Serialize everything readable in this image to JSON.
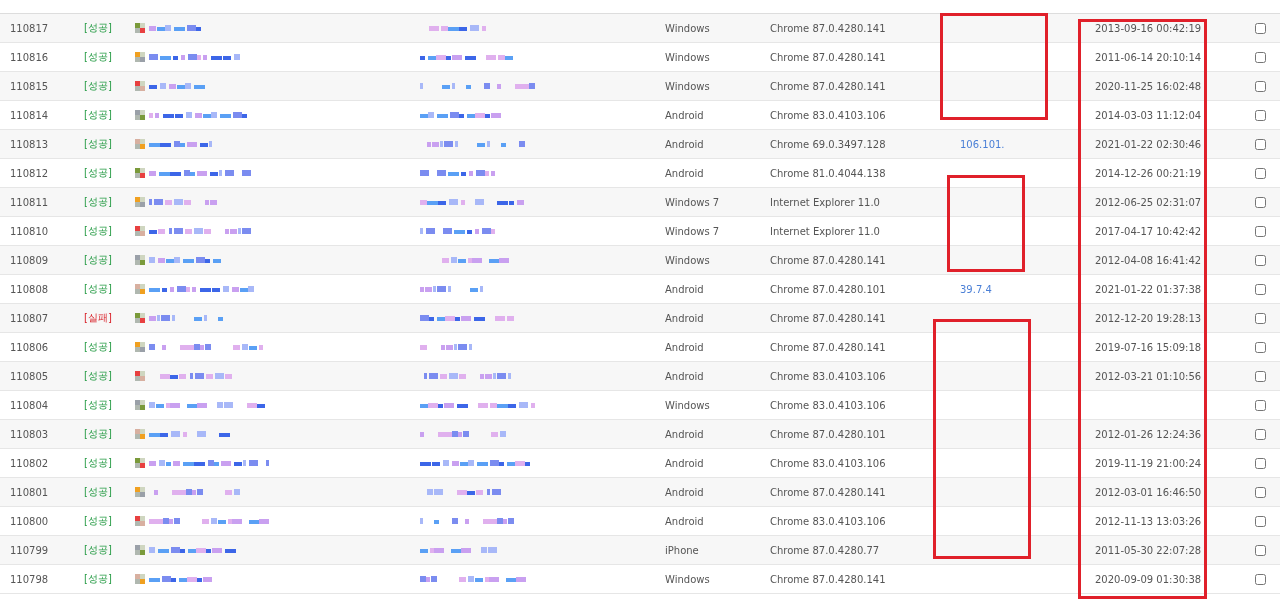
{
  "rows": [
    {
      "no": "110817",
      "result": {
        "kind": "success",
        "label": "[성공]"
      },
      "os": "Windows",
      "browser": "Chrome 87.0.4280.141",
      "date": "2013-09-16 00:42:19",
      "checked": false
    },
    {
      "no": "110816",
      "result": {
        "kind": "success",
        "label": "[성공]"
      },
      "os": "Windows",
      "browser": "Chrome 87.0.4280.141",
      "date": "2011-06-14 20:10:14",
      "checked": false
    },
    {
      "no": "110815",
      "result": {
        "kind": "success",
        "label": "[성공]"
      },
      "os": "Windows",
      "browser": "Chrome 87.0.4280.141",
      "date": "2020-11-25 16:02:48",
      "checked": false
    },
    {
      "no": "110814",
      "result": {
        "kind": "success",
        "label": "[성공]"
      },
      "os": "Android",
      "browser": "Chrome 83.0.4103.106",
      "date": "2014-03-03 11:12:04",
      "checked": false
    },
    {
      "no": "110813",
      "result": {
        "kind": "success",
        "label": "[성공]"
      },
      "os": "Android",
      "browser": "Chrome 69.0.3497.128",
      "ip": "106.101.",
      "date": "2021-01-22 02:30:46",
      "checked": false
    },
    {
      "no": "110812",
      "result": {
        "kind": "success",
        "label": "[성공]"
      },
      "os": "Android",
      "browser": "Chrome 81.0.4044.138",
      "date": "2014-12-26 00:21:19",
      "checked": false
    },
    {
      "no": "110811",
      "result": {
        "kind": "success",
        "label": "[성공]"
      },
      "os": "Windows 7",
      "browser": "Internet Explorer 11.0",
      "date": "2012-06-25 02:31:07",
      "checked": false
    },
    {
      "no": "110810",
      "result": {
        "kind": "success",
        "label": "[성공]"
      },
      "os": "Windows 7",
      "browser": "Internet Explorer 11.0",
      "date": "2017-04-17 10:42:42",
      "checked": false
    },
    {
      "no": "110809",
      "result": {
        "kind": "success",
        "label": "[성공]"
      },
      "os": "Windows",
      "browser": "Chrome 87.0.4280.141",
      "date": "2012-04-08 16:41:42",
      "checked": false
    },
    {
      "no": "110808",
      "result": {
        "kind": "success",
        "label": "[성공]"
      },
      "os": "Android",
      "browser": "Chrome 87.0.4280.101",
      "ip": "39.7.4",
      "date": "2021-01-22 01:37:38",
      "checked": false
    },
    {
      "no": "110807",
      "result": {
        "kind": "fail",
        "label": "[실패]"
      },
      "os": "Android",
      "browser": "Chrome 87.0.4280.141",
      "date": "2012-12-20 19:28:13",
      "checked": false
    },
    {
      "no": "110806",
      "result": {
        "kind": "success",
        "label": "[성공]"
      },
      "os": "Android",
      "browser": "Chrome 87.0.4280.141",
      "date": "2019-07-16 15:09:18",
      "checked": false
    },
    {
      "no": "110805",
      "result": {
        "kind": "success",
        "label": "[성공]"
      },
      "os": "Android",
      "browser": "Chrome 83.0.4103.106",
      "date": "2012-03-21 01:10:56",
      "checked": false
    },
    {
      "no": "110804",
      "result": {
        "kind": "success",
        "label": "[성공]"
      },
      "os": "Windows",
      "browser": "Chrome 83.0.4103.106",
      "checked": false
    },
    {
      "no": "110803",
      "result": {
        "kind": "success",
        "label": "[성공]"
      },
      "os": "Android",
      "browser": "Chrome 87.0.4280.101",
      "date": "2012-01-26 12:24:36",
      "checked": false
    },
    {
      "no": "110802",
      "result": {
        "kind": "success",
        "label": "[성공]"
      },
      "os": "Android",
      "browser": "Chrome 83.0.4103.106",
      "date": "2019-11-19 21:00:24",
      "checked": false
    },
    {
      "no": "110801",
      "result": {
        "kind": "success",
        "label": "[성공]"
      },
      "os": "Android",
      "browser": "Chrome 87.0.4280.141",
      "date": "2012-03-01 16:46:50",
      "checked": false
    },
    {
      "no": "110800",
      "result": {
        "kind": "success",
        "label": "[성공]"
      },
      "os": "Android",
      "browser": "Chrome 83.0.4103.106",
      "date": "2012-11-13 13:03:26",
      "checked": false
    },
    {
      "no": "110799",
      "result": {
        "kind": "success",
        "label": "[성공]"
      },
      "os": "iPhone",
      "browser": "Chrome 87.0.4280.77",
      "date": "2011-05-30 22:07:28",
      "checked": false
    },
    {
      "no": "110798",
      "result": {
        "kind": "success",
        "label": "[성공]"
      },
      "os": "Windows",
      "browser": "Chrome 87.0.4280.141",
      "date": "2020-09-09 01:30:38",
      "checked": false
    }
  ]
}
